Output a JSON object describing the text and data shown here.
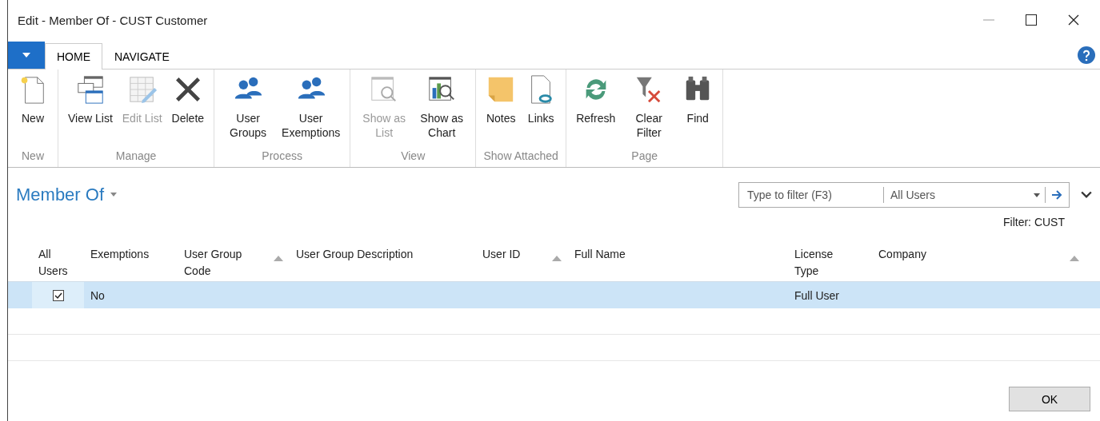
{
  "window": {
    "title": "Edit - Member Of - CUST Customer"
  },
  "tabs": [
    {
      "label": "HOME",
      "selected": true
    },
    {
      "label": "NAVIGATE",
      "selected": false
    }
  ],
  "ribbon": [
    {
      "label": "New",
      "actions": [
        {
          "label": "New",
          "kind": "new",
          "disabled": false
        }
      ]
    },
    {
      "label": "Manage",
      "actions": [
        {
          "label": "View List",
          "kind": "viewlist",
          "disabled": false
        },
        {
          "label": "Edit List",
          "kind": "editlist",
          "disabled": true
        },
        {
          "label": "Delete",
          "kind": "delete",
          "disabled": false
        }
      ]
    },
    {
      "label": "Process",
      "actions": [
        {
          "label": "User Groups",
          "kind": "users",
          "disabled": false
        },
        {
          "label": "User Exemptions",
          "kind": "users",
          "disabled": false
        }
      ]
    },
    {
      "label": "View",
      "actions": [
        {
          "label": "Show as List",
          "kind": "showlist",
          "disabled": true
        },
        {
          "label": "Show as Chart",
          "kind": "showchart",
          "disabled": false
        }
      ]
    },
    {
      "label": "Show Attached",
      "actions": [
        {
          "label": "Notes",
          "kind": "notes",
          "disabled": false
        },
        {
          "label": "Links",
          "kind": "links",
          "disabled": false
        }
      ]
    },
    {
      "label": "Page",
      "actions": [
        {
          "label": "Refresh",
          "kind": "refresh",
          "disabled": false
        },
        {
          "label": "Clear Filter",
          "kind": "clearfilter",
          "disabled": false
        },
        {
          "label": "Find",
          "kind": "find",
          "disabled": false
        }
      ]
    }
  ],
  "page_title": "Member Of",
  "filter": {
    "placeholder": "Type to filter (F3)",
    "field": "All Users"
  },
  "filter_summary": "Filter: CUST",
  "table": {
    "columns": [
      {
        "label": "All Users",
        "sorted": false
      },
      {
        "label": "Exemptions",
        "sorted": false
      },
      {
        "label": "User Group Code",
        "sorted": true
      },
      {
        "label": "User Group Description",
        "sorted": false
      },
      {
        "label": "User ID",
        "sorted": true
      },
      {
        "label": "Full Name",
        "sorted": false
      },
      {
        "label": "License Type",
        "sorted": false
      },
      {
        "label": "Company",
        "sorted": true
      }
    ],
    "rows": [
      {
        "selected": true,
        "all_users": true,
        "exemptions": "No",
        "license_type": "Full User"
      }
    ]
  },
  "buttons": [
    "OK"
  ]
}
